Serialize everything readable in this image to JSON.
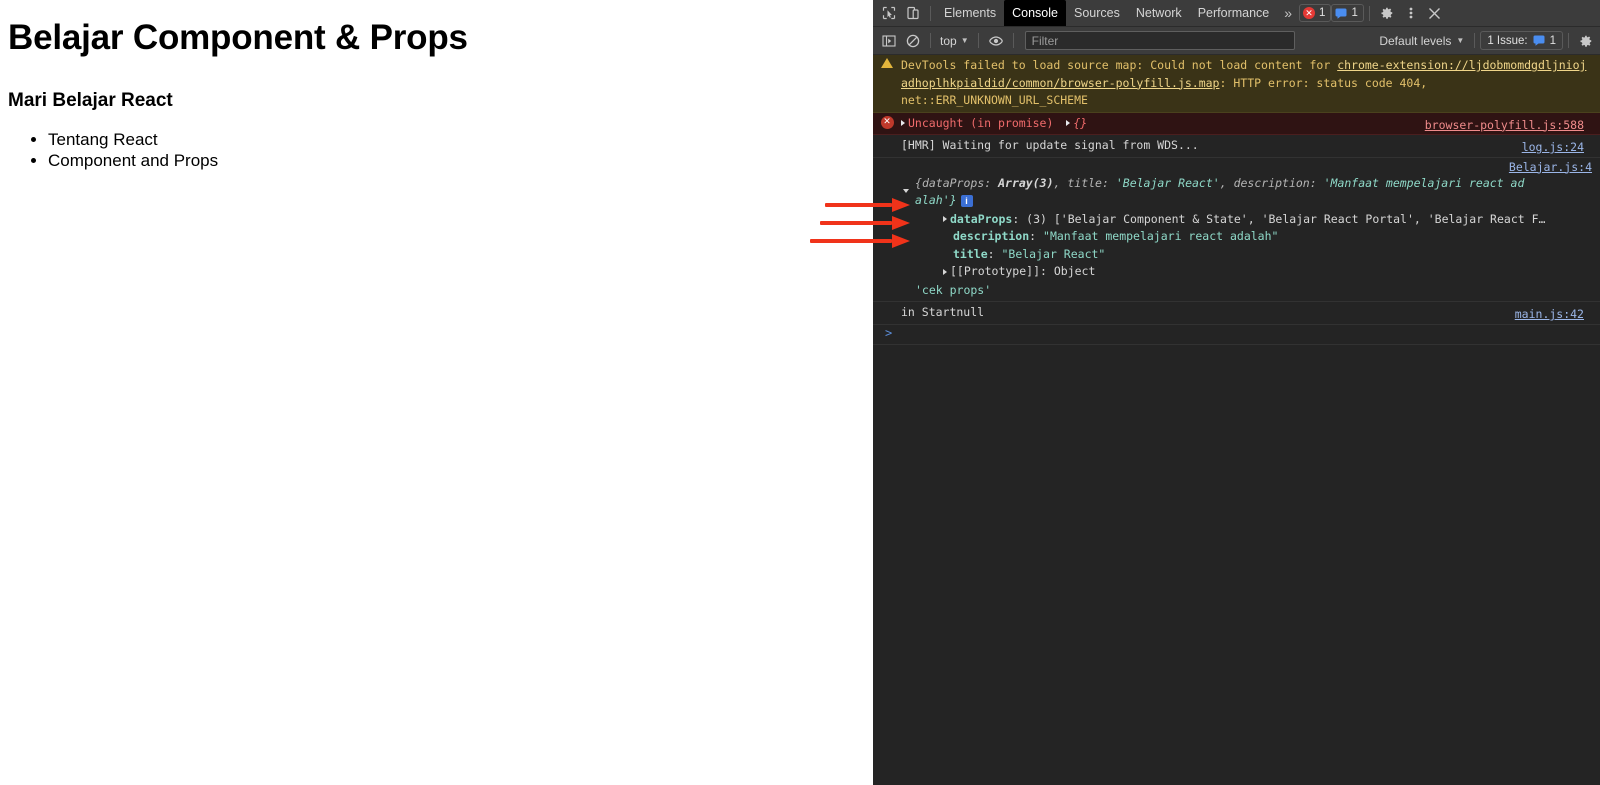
{
  "page": {
    "title": "Belajar Component & Props",
    "subtitle": "Mari Belajar React",
    "list": [
      "Tentang React",
      "Component and Props"
    ]
  },
  "devtools": {
    "tabbar": {
      "inspect_icon": "inspect-cursor-icon",
      "device_icon": "device-toolbar-icon",
      "tabs": [
        {
          "label": "Elements",
          "active": false
        },
        {
          "label": "Console",
          "active": true
        },
        {
          "label": "Sources",
          "active": false
        },
        {
          "label": "Network",
          "active": false
        },
        {
          "label": "Performance",
          "active": false
        }
      ],
      "more_label": "»",
      "error_count": "1",
      "message_count": "1",
      "settings_icon": "gear-icon",
      "kebab_icon": "more-vertical-icon",
      "close_icon": "close-icon"
    },
    "filterbar": {
      "sidebar_icon": "console-sidebar-icon",
      "clear_icon": "clear-console-icon",
      "context": "top",
      "eye_icon": "live-expression-eye-icon",
      "filter_placeholder": "Filter",
      "filter_value": "",
      "levels_label": "Default levels",
      "issues_label": "1 Issue:",
      "issues_count": "1",
      "settings_icon": "settings-gear-icon"
    },
    "messages": {
      "warning": {
        "icon": "warning-triangle-icon",
        "part1": "DevTools failed to load source map: Could not load content for ",
        "link1": "chrome-extension://ljdobmomdgdljniojadhoplhkpialdid/common/browser-polyfill.js.map",
        "part2": ": HTTP error: status code 404, net::ERR_UNKNOWN_URL_SCHEME"
      },
      "error": {
        "icon": "error-circle-icon",
        "text": "Uncaught (in promise)",
        "object": "{}",
        "source": "browser-polyfill.js:588"
      },
      "hmr": {
        "text": "[HMR] Waiting for update signal from WDS...",
        "source": "log.js:24"
      },
      "object_log": {
        "source": "Belajar.js:4",
        "summary_line1_a": "{",
        "summary_line1_b": "dataProps",
        "summary_line1_c": ": ",
        "summary_line1_d": "Array(3)",
        "summary_line1_e": ", ",
        "summary_line1_f": "title",
        "summary_line1_g": ": ",
        "summary_line1_h": "'Belajar React'",
        "summary_line1_i": ", ",
        "summary_line1_j": "description",
        "summary_line1_k": ": ",
        "summary_line1_l": "'Manfaat mempelajari react ad",
        "summary_line2": "alah'}",
        "props": [
          {
            "key": "dataProps",
            "value": "(3) ['Belajar Component & State', 'Belajar React Portal', 'Belajar React F…",
            "expandable": true,
            "style": "array"
          },
          {
            "key": "description",
            "value": "\"Manfaat mempelajari react adalah\"",
            "expandable": false,
            "style": "string"
          },
          {
            "key": "title",
            "value": "\"Belajar React\"",
            "expandable": false,
            "style": "string"
          }
        ],
        "prototype": "[[Prototype]]: Object"
      },
      "cek_props": "'cek props'",
      "start": {
        "text": "in Startnull",
        "source": "main.js:42"
      }
    },
    "prompt_caret": ">"
  },
  "annotations": {
    "arrow_color": "#f0331a",
    "arrows": [
      {
        "name": "arrow-to-dataprops"
      },
      {
        "name": "arrow-to-description"
      },
      {
        "name": "arrow-to-title"
      }
    ]
  }
}
